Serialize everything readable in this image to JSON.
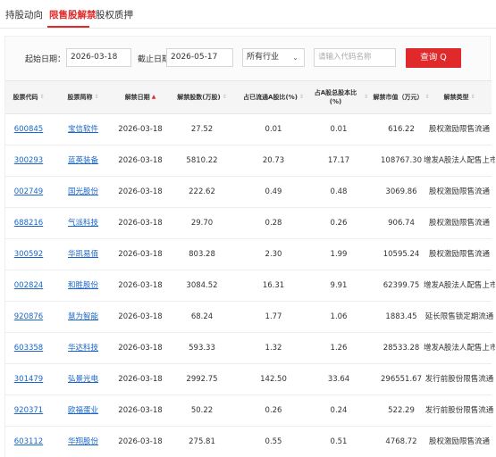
{
  "tabs": [
    "持股动向",
    "限售股解禁",
    "股权质押"
  ],
  "filter": {
    "start_label": "起始日期：",
    "start_value": "2026-03-18",
    "end_label": "截止日期：",
    "end_value": "2026-05-17",
    "industry_value": "所有行业",
    "search_placeholder": "请输入代码名称",
    "query_label": "查询 Q"
  },
  "columns": [
    {
      "label": "股票代码",
      "sort": "⇕",
      "active": false
    },
    {
      "label": "股票简称",
      "sort": "⇕",
      "active": false
    },
    {
      "label": "解禁日期",
      "sort": "▲",
      "active": true
    },
    {
      "label": "解禁股数(万股)",
      "sort": "⇕",
      "active": false
    },
    {
      "label": "占已流通A股比(%)",
      "sort": "⇕",
      "active": false
    },
    {
      "label": "占A股总股本比(%)",
      "sort": "⇕",
      "active": false
    },
    {
      "label": "解禁市值（万元）",
      "sort": "⇕",
      "active": false
    },
    {
      "label": "解禁类型",
      "sort": "⇕",
      "active": false
    }
  ],
  "rows": [
    [
      "600845",
      "宝信软件",
      "2026-03-18",
      "27.52",
      "0.01",
      "0.01",
      "616.22",
      "股权激励限售流通"
    ],
    [
      "300293",
      "蓝英装备",
      "2026-03-18",
      "5810.22",
      "20.73",
      "17.17",
      "108767.30",
      "增发A股法人配售上市"
    ],
    [
      "002749",
      "国光股份",
      "2026-03-18",
      "222.62",
      "0.49",
      "0.48",
      "3069.86",
      "股权激励限售流通"
    ],
    [
      "688216",
      "气派科技",
      "2026-03-18",
      "29.70",
      "0.28",
      "0.26",
      "906.74",
      "股权激励限售流通"
    ],
    [
      "300592",
      "华凯易佰",
      "2026-03-18",
      "803.28",
      "2.30",
      "1.99",
      "10595.24",
      "股权激励限售流通"
    ],
    [
      "002824",
      "和胜股份",
      "2026-03-18",
      "3084.52",
      "16.31",
      "9.91",
      "62399.75",
      "增发A股法人配售上市"
    ],
    [
      "920876",
      "慧为智能",
      "2026-03-18",
      "68.24",
      "1.77",
      "1.06",
      "1883.45",
      "延长限售锁定期流通"
    ],
    [
      "603358",
      "华达科技",
      "2026-03-18",
      "593.33",
      "1.32",
      "1.26",
      "28533.28",
      "增发A股法人配售上市"
    ],
    [
      "301479",
      "弘景光电",
      "2026-03-18",
      "2992.75",
      "142.50",
      "33.64",
      "296551.67",
      "发行前股份限售流通"
    ],
    [
      "920371",
      "欧福蛋业",
      "2026-03-18",
      "50.22",
      "0.26",
      "0.24",
      "522.29",
      "发行前股份限售流通"
    ],
    [
      "603112",
      "华翔股份",
      "2026-03-18",
      "275.81",
      "0.55",
      "0.51",
      "4768.72",
      "股权激励限售流通"
    ]
  ]
}
